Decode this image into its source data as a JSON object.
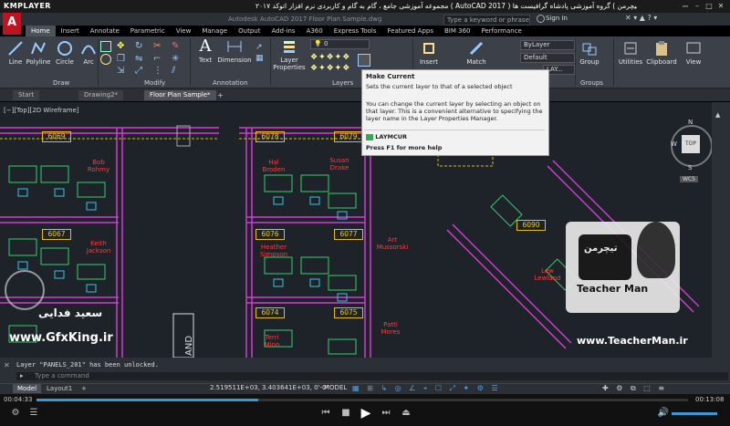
{
  "player": {
    "logo": "KMPLAYER",
    "title": "مجموعه آموزشی جامع ، گام به گام و کاربردی نرم افزار اتوکد ۲۰۱۷ ( AutoCAD 2017 ) مدرس : سعید فدایی ( تیچرمن ) گروه آموزشی پادشاه گرافیست ها",
    "time_current": "00:04:33",
    "time_total": "00:13:08",
    "progress": 0.34
  },
  "acad": {
    "doc_title": "Autodesk AutoCAD 2017   Floor Plan Sample.dwg",
    "search_placeholder": "Type a keyword or phrase",
    "signin": "Sign In"
  },
  "ribbon_tabs": [
    "Home",
    "Insert",
    "Annotate",
    "Parametric",
    "View",
    "Manage",
    "Output",
    "Add-ins",
    "A360",
    "Express Tools",
    "Featured Apps",
    "BIM 360",
    "Performance"
  ],
  "ribbon": {
    "draw_tools": [
      "Line",
      "Polyline",
      "Circle",
      "Arc"
    ],
    "modify_tools": [],
    "annotation_tools": [
      "Text",
      "Dimension"
    ],
    "layer_props": "Layer\nProperties",
    "insert": "Insert",
    "match": "Match",
    "group": "Group",
    "utilities": "Utilities",
    "clipboard": "Clipboard",
    "view": "View",
    "layer_combo": "0",
    "bylayer": "ByLayer",
    "default": "Default",
    "bylayer2": "LAY...",
    "panels": [
      "Draw",
      "Modify",
      "Annotation",
      "Layers",
      "Groups"
    ]
  },
  "file_tabs": [
    "Start",
    "Drawing2*",
    "Floor Plan Sample*"
  ],
  "viewport_label": "[−][Top][2D Wireframe]",
  "tooltip": {
    "title": "Make Current",
    "desc": "Sets the current layer to that of a selected object",
    "detail": "You can change the current layer by selecting an object on that layer. This is a convenient alternative to specifying the layer name in the Layer Properties Manager.",
    "command": "LAYMCUR",
    "help": "Press F1 for more help"
  },
  "drawing": {
    "rooms": [
      {
        "num": "6069",
        "name": "Bob\nRohmy"
      },
      {
        "num": "6078",
        "name": "Hal\nBroden"
      },
      {
        "num": "6079",
        "name": "Susan\nDrake"
      },
      {
        "num": "6067",
        "name": "Keith\nJackson"
      },
      {
        "num": "6076",
        "name": "Heather\nSimpson"
      },
      {
        "num": "6077",
        "name": "Art\nMussorski"
      },
      {
        "num": "6074",
        "name": "Terri\nMino"
      },
      {
        "num": "6075",
        "name": "Patti\nMores"
      },
      {
        "num": "6090",
        "name": "Lew\nLewland"
      }
    ],
    "stairs": "AND",
    "compass": {
      "n": "N",
      "s": "S",
      "w": "W",
      "top": "TOP"
    },
    "wcs": "WCS"
  },
  "command": {
    "history": "Layer \"PANELS_201\" has been unlocked.",
    "placeholder": "Type a command"
  },
  "status": {
    "tabs": [
      "Model",
      "Layout1",
      "+"
    ],
    "coords": "2.519511E+03, 3.403641E+03, 0'-0\"",
    "model": "MODEL"
  },
  "watermarks": {
    "left_name": "سعید فدایی",
    "left_site": "www.GfxKing.ir",
    "right_site": "www.TeacherMan.ir",
    "teacher": "Teacher Man",
    "logo_fa": "تیچرمن"
  }
}
